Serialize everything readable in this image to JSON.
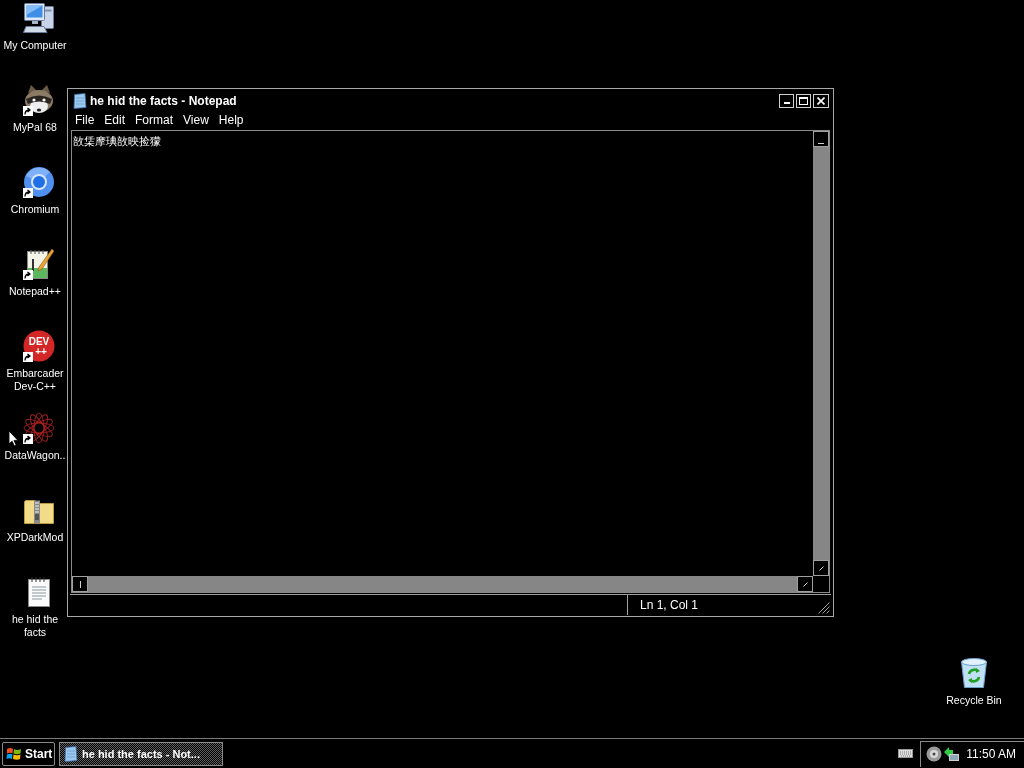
{
  "desktop": {
    "icons": [
      {
        "kind": "computer",
        "label": "My Computer",
        "shortcut": false
      },
      {
        "kind": "raccoon",
        "label": "MyPal 68",
        "shortcut": true
      },
      {
        "kind": "chromium",
        "label": "Chromium",
        "shortcut": true
      },
      {
        "kind": "notepadpp",
        "label": "Notepad++",
        "shortcut": true
      },
      {
        "kind": "devcpp",
        "label": "Embarcader Dev-C++",
        "shortcut": true,
        "logo_text": [
          "DEV",
          "++"
        ]
      },
      {
        "kind": "datawagon",
        "label": "DataWagon..",
        "shortcut": true
      },
      {
        "kind": "zipfolder",
        "label": "XPDarkMod",
        "shortcut": false
      },
      {
        "kind": "textfile",
        "label": "he hid the facts",
        "shortcut": false
      }
    ],
    "recycle_bin": {
      "label": "Recycle Bin"
    }
  },
  "window": {
    "title": "he hid the facts - Notepad",
    "menu": [
      "File",
      "Edit",
      "Format",
      "View",
      "Help"
    ],
    "text": "敨栠摩琠敨映捡獴",
    "status": "Ln 1, Col 1"
  },
  "taskbar": {
    "start": "Start",
    "tasks": [
      {
        "label": "he hid the facts - Not...",
        "selected": true
      }
    ],
    "clock": "11:50 AM"
  }
}
